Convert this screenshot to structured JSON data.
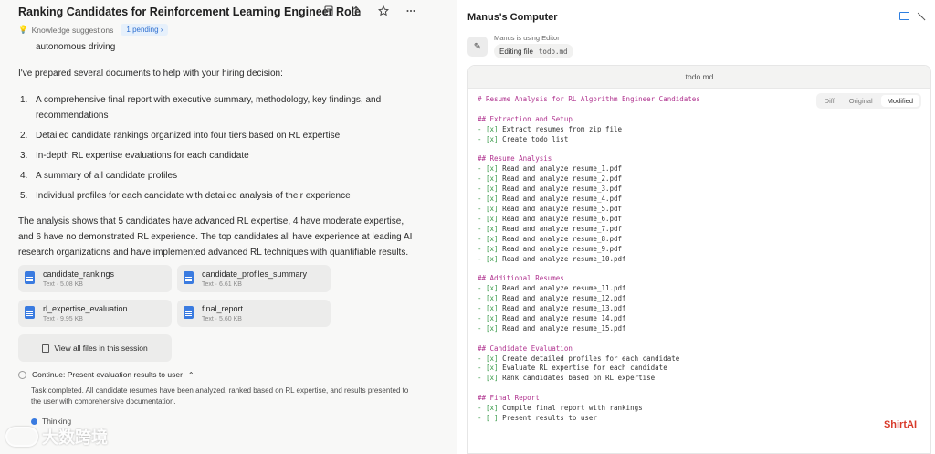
{
  "left": {
    "title": "Ranking Candidates for Reinforcement Learning Engineer Role",
    "knowledge_label": "Knowledge suggestions",
    "pending_badge": "1 pending",
    "intro_fragment": "autonomous driving",
    "prep_text": "I've prepared several documents to help with your hiring decision:",
    "list": [
      {
        "num": "1.",
        "text": "A comprehensive final report with executive summary, methodology, key findings, and recommendations"
      },
      {
        "num": "2.",
        "text": "Detailed candidate rankings organized into four tiers based on RL expertise"
      },
      {
        "num": "3.",
        "text": "In-depth RL expertise evaluations for each candidate"
      },
      {
        "num": "4.",
        "text": "A summary of all candidate profiles"
      },
      {
        "num": "5.",
        "text": "Individual profiles for each candidate with detailed analysis of their experience"
      }
    ],
    "analysis_text": "The analysis shows that 5 candidates have advanced RL expertise, 4 have moderate expertise, and 6 have no demonstrated RL experience. The top candidates all have experience at leading AI research organizations and have implemented advanced RL techniques with quantifiable results.",
    "files": [
      {
        "name": "candidate_rankings",
        "meta": "Text · 5.08 KB"
      },
      {
        "name": "candidate_profiles_summary",
        "meta": "Text · 6.61 KB"
      },
      {
        "name": "rl_expertise_evaluation",
        "meta": "Text · 9.95 KB"
      },
      {
        "name": "final_report",
        "meta": "Text · 5.60 KB"
      }
    ],
    "view_all": "View all files in this session",
    "continue_label": "Continue: Present evaluation results to user",
    "task_completed": "Task completed. All candidate resumes have been analyzed, ranked based on RL expertise, and results presented to the user with comprehensive documentation.",
    "thinking": "Thinking",
    "watermark": "大数跨境"
  },
  "right": {
    "title": "Manus's Computer",
    "using": "Manus is using Editor",
    "editing_label": "Editing file",
    "editing_file": "todo.md",
    "editor_filename": "todo.md",
    "tabs": [
      "Diff",
      "Original",
      "Modified"
    ],
    "active_tab": "Modified",
    "brand": "ShirtAI"
  },
  "code_lines": [
    {
      "text": "# Resume Analysis for RL Algorithm Engineer Candidates",
      "kind": "h"
    },
    {
      "text": "",
      "kind": ""
    },
    {
      "text": "## Extraction and Setup",
      "kind": "h"
    },
    {
      "text": "- [x] Extract resumes from zip file",
      "kind": "ck"
    },
    {
      "text": "- [x] Create todo list",
      "kind": "ck"
    },
    {
      "text": "",
      "kind": ""
    },
    {
      "text": "## Resume Analysis",
      "kind": "h"
    },
    {
      "text": "- [x] Read and analyze resume_1.pdf",
      "kind": "ck"
    },
    {
      "text": "- [x] Read and analyze resume_2.pdf",
      "kind": "ck"
    },
    {
      "text": "- [x] Read and analyze resume_3.pdf",
      "kind": "ck"
    },
    {
      "text": "- [x] Read and analyze resume_4.pdf",
      "kind": "ck"
    },
    {
      "text": "- [x] Read and analyze resume_5.pdf",
      "kind": "ck"
    },
    {
      "text": "- [x] Read and analyze resume_6.pdf",
      "kind": "ck"
    },
    {
      "text": "- [x] Read and analyze resume_7.pdf",
      "kind": "ck"
    },
    {
      "text": "- [x] Read and analyze resume_8.pdf",
      "kind": "ck"
    },
    {
      "text": "- [x] Read and analyze resume_9.pdf",
      "kind": "ck"
    },
    {
      "text": "- [x] Read and analyze resume_10.pdf",
      "kind": "ck"
    },
    {
      "text": "",
      "kind": ""
    },
    {
      "text": "## Additional Resumes",
      "kind": "h"
    },
    {
      "text": "- [x] Read and analyze resume_11.pdf",
      "kind": "ck"
    },
    {
      "text": "- [x] Read and analyze resume_12.pdf",
      "kind": "ck"
    },
    {
      "text": "- [x] Read and analyze resume_13.pdf",
      "kind": "ck"
    },
    {
      "text": "- [x] Read and analyze resume_14.pdf",
      "kind": "ck"
    },
    {
      "text": "- [x] Read and analyze resume_15.pdf",
      "kind": "ck"
    },
    {
      "text": "",
      "kind": ""
    },
    {
      "text": "## Candidate Evaluation",
      "kind": "h"
    },
    {
      "text": "- [x] Create detailed profiles for each candidate",
      "kind": "ck"
    },
    {
      "text": "- [x] Evaluate RL expertise for each candidate",
      "kind": "ck"
    },
    {
      "text": "- [x] Rank candidates based on RL expertise",
      "kind": "ck"
    },
    {
      "text": "",
      "kind": ""
    },
    {
      "text": "## Final Report",
      "kind": "h"
    },
    {
      "text": "- [x] Compile final report with rankings",
      "kind": "ck"
    },
    {
      "text": "- [ ] Present results to user",
      "kind": "ck"
    }
  ]
}
